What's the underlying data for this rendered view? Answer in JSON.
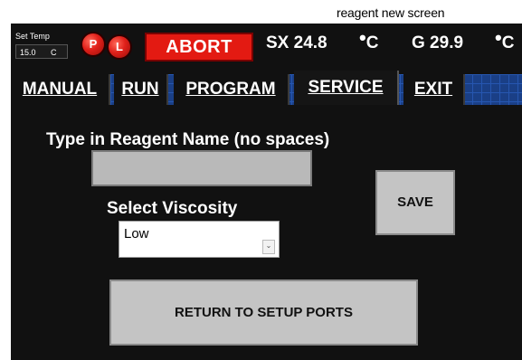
{
  "caption": "reagent new screen",
  "header": {
    "set_temp_label": "Set Temp",
    "set_temp_value": "15.0",
    "set_temp_unit": "C",
    "p_label": "P",
    "l_label": "L",
    "abort_label": "ABORT",
    "sx_reading": "SX 24.8",
    "sx_unit": "C",
    "g_reading": "G 29.9",
    "g_unit": "C"
  },
  "tabs": [
    {
      "label": "MANUAL"
    },
    {
      "label": "RUN"
    },
    {
      "label": "PROGRAM"
    },
    {
      "label": "SERVICE"
    },
    {
      "label": "EXIT"
    }
  ],
  "form": {
    "prompt": "Type in Reagent Name (no spaces)",
    "name_value": "",
    "viscosity_label": "Select Viscosity",
    "viscosity_selected": "Low",
    "save_label": "SAVE",
    "return_label": "RETURN TO SETUP PORTS"
  },
  "colors": {
    "background": "#111111",
    "abort_red": "#e31a12",
    "button_gray": "#c4c4c4",
    "tab_strip_blue": "#1a3f86"
  }
}
